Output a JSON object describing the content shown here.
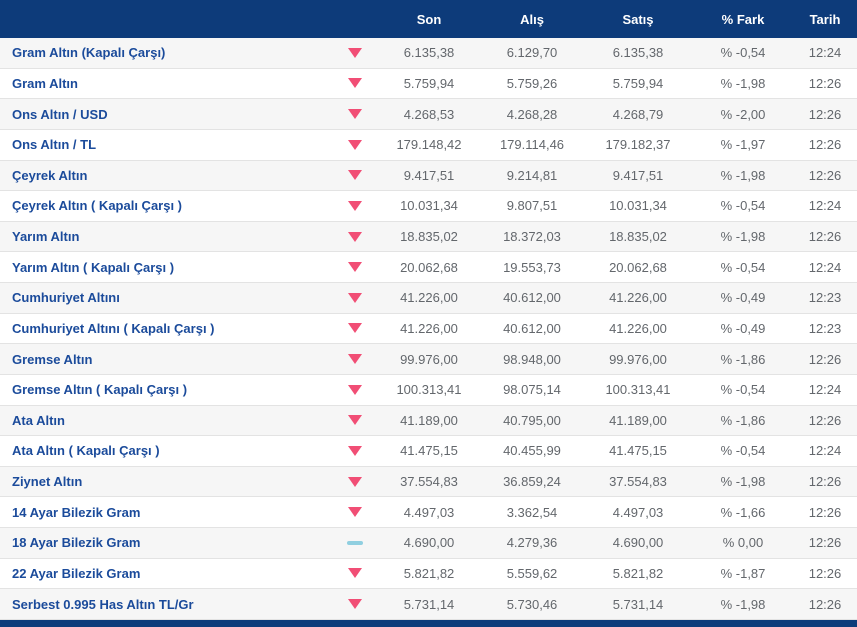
{
  "colors": {
    "header_bg": "#0d3b7a",
    "footer_bg": "#0d3b7a",
    "name_link": "#1b4b9b",
    "value_text": "#63676c",
    "down_indicator": "#f14e75",
    "flat_indicator": "#90cfe0",
    "row_stripe": "#f6f6f6",
    "row_border": "#e3e3e3"
  },
  "table": {
    "headers": {
      "name": "",
      "indicator": "",
      "son": "Son",
      "alis": "Alış",
      "satis": "Satış",
      "fark": "% Fark",
      "tarih": "Tarih"
    },
    "rows": [
      {
        "name": "Gram Altın (Kapalı Çarşı)",
        "direction": "down",
        "son": "6.135,38",
        "alis": "6.129,70",
        "satis": "6.135,38",
        "fark": "% -0,54",
        "tarih": "12:24"
      },
      {
        "name": "Gram Altın",
        "direction": "down",
        "son": "5.759,94",
        "alis": "5.759,26",
        "satis": "5.759,94",
        "fark": "% -1,98",
        "tarih": "12:26"
      },
      {
        "name": "Ons Altın / USD",
        "direction": "down",
        "son": "4.268,53",
        "alis": "4.268,28",
        "satis": "4.268,79",
        "fark": "% -2,00",
        "tarih": "12:26"
      },
      {
        "name": "Ons Altın / TL",
        "direction": "down",
        "son": "179.148,42",
        "alis": "179.114,46",
        "satis": "179.182,37",
        "fark": "% -1,97",
        "tarih": "12:26"
      },
      {
        "name": "Çeyrek Altın",
        "direction": "down",
        "son": "9.417,51",
        "alis": "9.214,81",
        "satis": "9.417,51",
        "fark": "% -1,98",
        "tarih": "12:26"
      },
      {
        "name": "Çeyrek Altın ( Kapalı Çarşı )",
        "direction": "down",
        "son": "10.031,34",
        "alis": "9.807,51",
        "satis": "10.031,34",
        "fark": "% -0,54",
        "tarih": "12:24"
      },
      {
        "name": "Yarım Altın",
        "direction": "down",
        "son": "18.835,02",
        "alis": "18.372,03",
        "satis": "18.835,02",
        "fark": "% -1,98",
        "tarih": "12:26"
      },
      {
        "name": "Yarım Altın ( Kapalı Çarşı )",
        "direction": "down",
        "son": "20.062,68",
        "alis": "19.553,73",
        "satis": "20.062,68",
        "fark": "% -0,54",
        "tarih": "12:24"
      },
      {
        "name": "Cumhuriyet Altını",
        "direction": "down",
        "son": "41.226,00",
        "alis": "40.612,00",
        "satis": "41.226,00",
        "fark": "% -0,49",
        "tarih": "12:23"
      },
      {
        "name": "Cumhuriyet Altını ( Kapalı Çarşı )",
        "direction": "down",
        "son": "41.226,00",
        "alis": "40.612,00",
        "satis": "41.226,00",
        "fark": "% -0,49",
        "tarih": "12:23"
      },
      {
        "name": "Gremse Altın",
        "direction": "down",
        "son": "99.976,00",
        "alis": "98.948,00",
        "satis": "99.976,00",
        "fark": "% -1,86",
        "tarih": "12:26"
      },
      {
        "name": "Gremse Altın ( Kapalı Çarşı )",
        "direction": "down",
        "son": "100.313,41",
        "alis": "98.075,14",
        "satis": "100.313,41",
        "fark": "% -0,54",
        "tarih": "12:24"
      },
      {
        "name": "Ata Altın",
        "direction": "down",
        "son": "41.189,00",
        "alis": "40.795,00",
        "satis": "41.189,00",
        "fark": "% -1,86",
        "tarih": "12:26"
      },
      {
        "name": "Ata Altın ( Kapalı Çarşı )",
        "direction": "down",
        "son": "41.475,15",
        "alis": "40.455,99",
        "satis": "41.475,15",
        "fark": "% -0,54",
        "tarih": "12:24"
      },
      {
        "name": "Ziynet Altın",
        "direction": "down",
        "son": "37.554,83",
        "alis": "36.859,24",
        "satis": "37.554,83",
        "fark": "% -1,98",
        "tarih": "12:26"
      },
      {
        "name": "14 Ayar Bilezik Gram",
        "direction": "down",
        "son": "4.497,03",
        "alis": "3.362,54",
        "satis": "4.497,03",
        "fark": "% -1,66",
        "tarih": "12:26"
      },
      {
        "name": "18 Ayar Bilezik Gram",
        "direction": "flat",
        "son": "4.690,00",
        "alis": "4.279,36",
        "satis": "4.690,00",
        "fark": "% 0,00",
        "tarih": "12:26"
      },
      {
        "name": "22 Ayar Bilezik Gram",
        "direction": "down",
        "son": "5.821,82",
        "alis": "5.559,62",
        "satis": "5.821,82",
        "fark": "% -1,87",
        "tarih": "12:26"
      },
      {
        "name": "Serbest 0.995 Has Altın TL/Gr",
        "direction": "down",
        "son": "5.731,14",
        "alis": "5.730,46",
        "satis": "5.731,14",
        "fark": "% -1,98",
        "tarih": "12:26"
      }
    ]
  }
}
